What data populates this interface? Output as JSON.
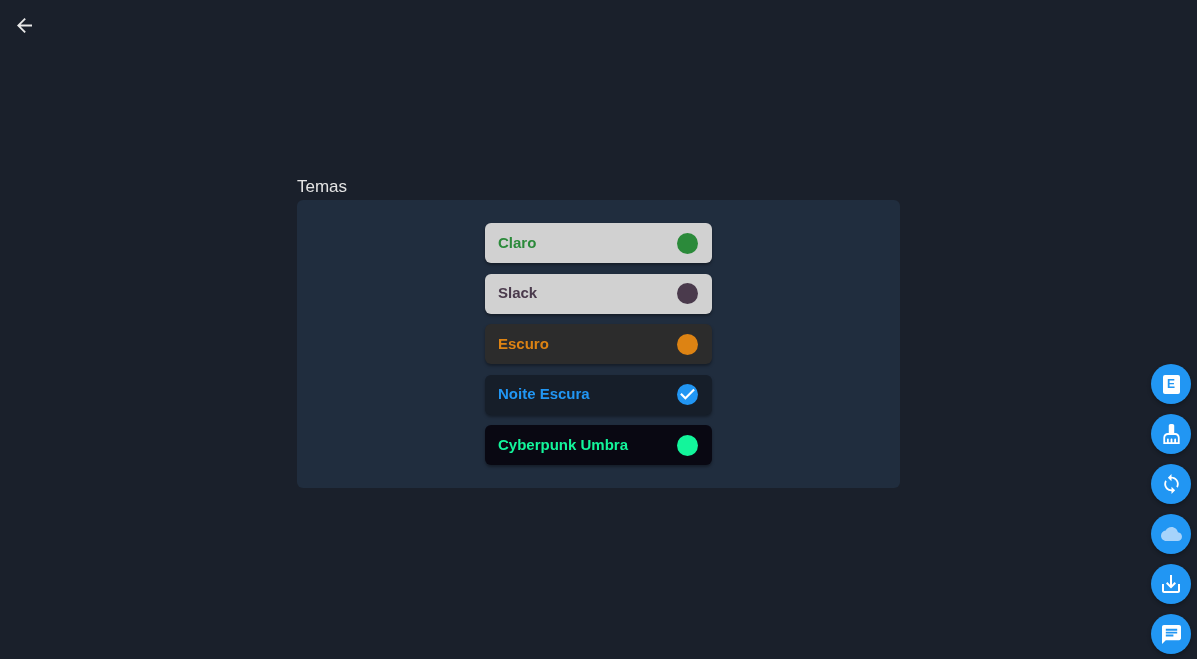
{
  "section": {
    "title": "Temas"
  },
  "themes": [
    {
      "label": "Claro",
      "selected": false,
      "color": "#2b8a3a",
      "card": {
        "color": "#d1d1d1"
      }
    },
    {
      "label": "Slack",
      "selected": false,
      "color": "#4a3a4c",
      "card": {
        "color": "#d1d1d1"
      }
    },
    {
      "label": "Escuro",
      "selected": false,
      "color": "#dd8313",
      "card": {
        "color": "#2c2c2c"
      }
    },
    {
      "label": "Noite Escura",
      "selected": true,
      "color": "#2196f3",
      "card": {
        "color": "#161e29"
      }
    },
    {
      "label": "Cyberpunk Umbra",
      "selected": false,
      "color": "#13f59b",
      "card": {
        "color": "#090812"
      }
    }
  ],
  "side_actions": [
    {
      "kind": "letter",
      "text": "E"
    },
    {
      "kind": "broom"
    },
    {
      "kind": "sync"
    },
    {
      "kind": "cloud"
    },
    {
      "kind": "download"
    },
    {
      "kind": "chat"
    }
  ]
}
